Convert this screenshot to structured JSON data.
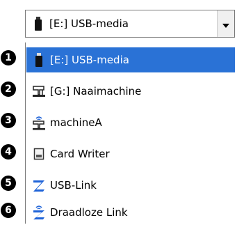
{
  "combo": {
    "selected_label": "[E:] USB-media",
    "selected_icon": "usb-stick-icon",
    "arrow_icon": "chevron-down-icon"
  },
  "list": {
    "items": [
      {
        "number": "1",
        "label": "[E:] USB-media",
        "icon": "usb-stick-icon",
        "selected": true
      },
      {
        "number": "2",
        "label": "[G:] Naaimachine",
        "icon": "sewing-machine-icon",
        "selected": false
      },
      {
        "number": "3",
        "label": "machineA",
        "icon": "wireless-sewing-machine-icon",
        "selected": false
      },
      {
        "number": "4",
        "label": "Card Writer",
        "icon": "card-writer-icon",
        "selected": false
      },
      {
        "number": "5",
        "label": "USB-Link",
        "icon": "usb-link-icon",
        "selected": false
      },
      {
        "number": "6",
        "label": "Draadloze Link",
        "icon": "wireless-link-icon",
        "selected": false
      }
    ]
  },
  "colors": {
    "selection": "#2a72d6",
    "link_blue": "#1e63d8"
  }
}
